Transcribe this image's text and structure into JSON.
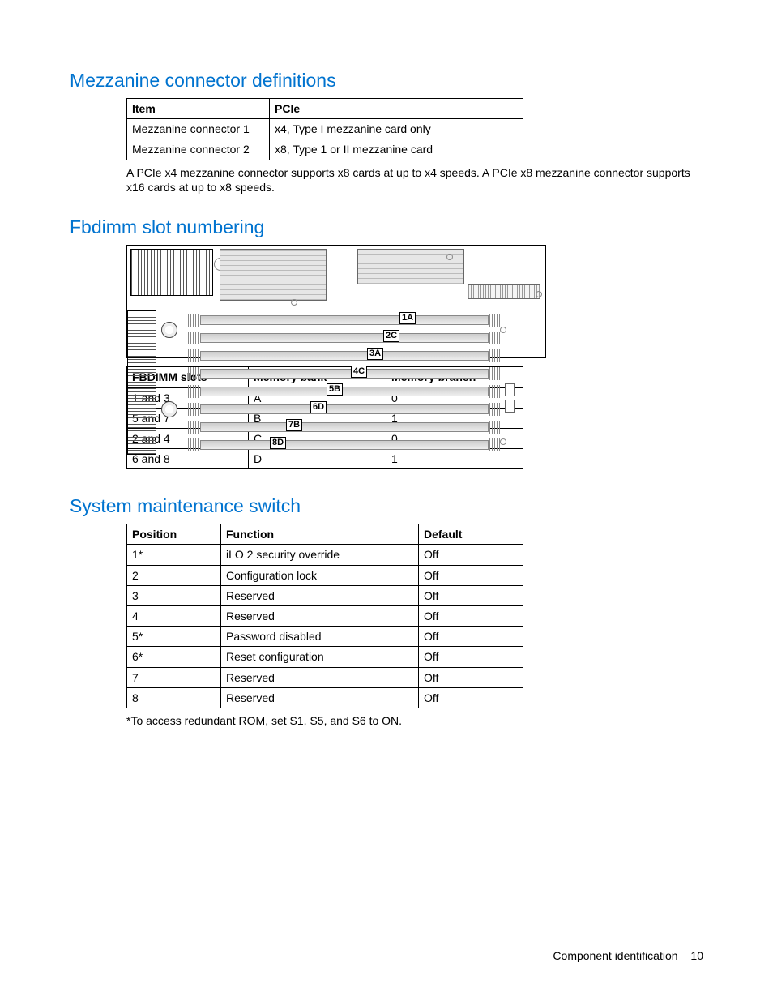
{
  "sections": {
    "mezz_title": "Mezzanine connector definitions",
    "fbdimm_title": "Fbdimm slot numbering",
    "sms_title": "System maintenance switch"
  },
  "mezz_table": {
    "headers": [
      "Item",
      "PCIe"
    ],
    "rows": [
      [
        "Mezzanine connector 1",
        "x4, Type I mezzanine card only"
      ],
      [
        "Mezzanine connector 2",
        "x8, Type 1 or II mezzanine card"
      ]
    ]
  },
  "mezz_note": "A PCIe x4 mezzanine connector supports x8 cards at up to x4 speeds. A PCIe x8 mezzanine connector supports x16 cards at up to x8 speeds.",
  "dimm_labels": [
    "1A",
    "2C",
    "3A",
    "4C",
    "5B",
    "6D",
    "7B",
    "8D"
  ],
  "fbdimm_table": {
    "headers": [
      "FBDIMM slots",
      "Memory bank",
      "Memory branch"
    ],
    "rows": [
      [
        "1 and 3",
        "A",
        "0"
      ],
      [
        "5 and 7",
        "B",
        "1"
      ],
      [
        "2 and 4",
        "C",
        "0"
      ],
      [
        "6 and 8",
        "D",
        "1"
      ]
    ]
  },
  "sms_table": {
    "headers": [
      "Position",
      "Function",
      "Default"
    ],
    "rows": [
      [
        "1*",
        "iLO 2 security override",
        "Off"
      ],
      [
        "2",
        "Configuration lock",
        "Off"
      ],
      [
        "3",
        "Reserved",
        "Off"
      ],
      [
        "4",
        "Reserved",
        "Off"
      ],
      [
        "5*",
        "Password disabled",
        "Off"
      ],
      [
        "6*",
        "Reset configuration",
        "Off"
      ],
      [
        "7",
        "Reserved",
        "Off"
      ],
      [
        "8",
        "Reserved",
        "Off"
      ]
    ]
  },
  "sms_note": "*To access redundant ROM, set S1, S5, and S6 to ON.",
  "footer": {
    "section": "Component identification",
    "page": "10"
  }
}
